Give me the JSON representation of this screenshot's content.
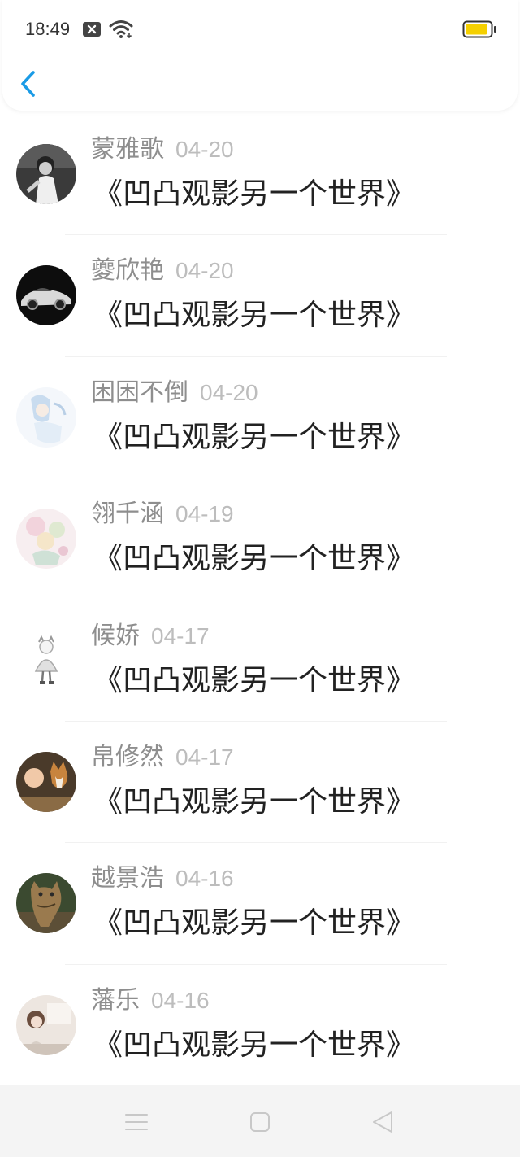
{
  "status_bar": {
    "time": "18:49",
    "icons": [
      "notification-x-icon",
      "wifi-icon",
      "battery-icon"
    ],
    "battery_color": "#f5d000"
  },
  "header": {
    "back_icon": "chevron-left-icon",
    "accent_color": "#1a9be6"
  },
  "comments": [
    {
      "name": "蒙雅歌",
      "date": "04-20",
      "text": "《凹凸观影另一个世界》"
    },
    {
      "name": "夔欣艳",
      "date": "04-20",
      "text": "《凹凸观影另一个世界》"
    },
    {
      "name": "困困不倒",
      "date": "04-20",
      "text": "《凹凸观影另一个世界》"
    },
    {
      "name": "翎千涵",
      "date": "04-19",
      "text": "《凹凸观影另一个世界》"
    },
    {
      "name": "候娇",
      "date": "04-17",
      "text": "《凹凸观影另一个世界》"
    },
    {
      "name": "帛修然",
      "date": "04-17",
      "text": "《凹凸观影另一个世界》"
    },
    {
      "name": "越景浩",
      "date": "04-16",
      "text": "《凹凸观影另一个世界》"
    },
    {
      "name": "藩乐",
      "date": "04-16",
      "text": "《凹凸观影另一个世界》"
    }
  ],
  "nav_bar": {
    "icons": [
      "menu-icon",
      "home-square-icon",
      "back-triangle-icon"
    ]
  }
}
